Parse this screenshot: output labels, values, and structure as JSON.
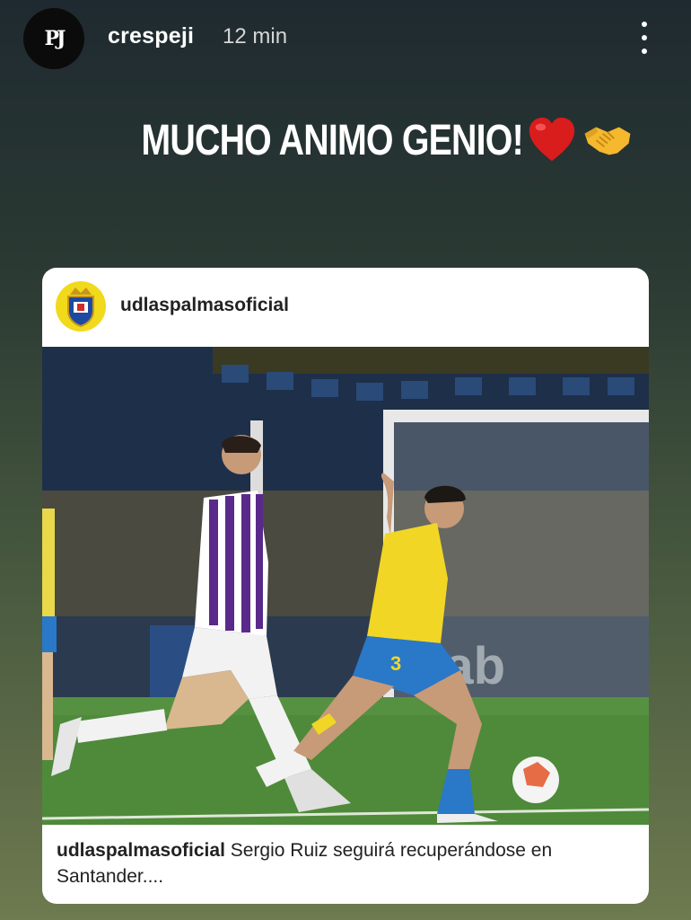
{
  "story": {
    "username": "crespeji",
    "time": "12 min",
    "avatar_text": "PJ",
    "caption": "MUCHO ANIMO GENIO!",
    "emojis": [
      "red-heart",
      "handshake"
    ]
  },
  "post": {
    "username": "udlaspalmasoficial",
    "caption_user": "udlaspalmasoficial",
    "caption_text": " Sergio Ruiz seguirá recuperándose en Santander....",
    "photo": {
      "player_number": "3",
      "sponsor": "ixab"
    }
  },
  "colors": {
    "background_top": "#1f2a30",
    "background_bottom": "#6e7a4f",
    "text": "#ffffff",
    "card": "#ffffff"
  }
}
